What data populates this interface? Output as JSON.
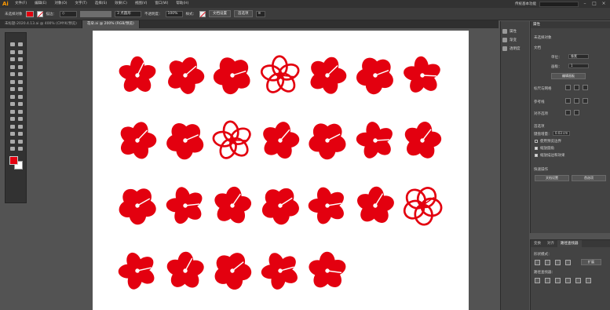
{
  "app": {
    "logo": "Ai"
  },
  "menu": [
    "文件(F)",
    "编辑(E)",
    "对象(O)",
    "文字(T)",
    "选择(S)",
    "效果(C)",
    "视图(V)",
    "窗口(W)",
    "帮助(H)"
  ],
  "workspace": "传统基本功能",
  "control_bar": {
    "selection_label": "未选择对象",
    "stroke_label": "描边：",
    "brush_label": "3 点圆形",
    "opacity_label": "不透明度：",
    "opacity_value": "100%",
    "style_label": "样式：",
    "doc_setup_button": "文档设置",
    "prefs_button": "首选项"
  },
  "document_tabs": [
    {
      "label": "未标题-2020.4.13.ai @ 400% (CMYK/预览)",
      "active": false
    },
    {
      "label": "花朵.ai @ 200% (RGB/预览)",
      "active": true
    }
  ],
  "dock": [
    "属性",
    "渐变",
    "透明度"
  ],
  "properties": {
    "title": "属性",
    "no_selection": "未选择对象",
    "document_section": "文档",
    "units_label": "单位：",
    "units_value": "像素",
    "artboard_label": "画板：",
    "artboard_value": "1",
    "edit_artboard_button": "编辑画板",
    "ruler_grid_label": "标尺与网格",
    "guides_label": "参考线",
    "align_label": "对齐选项",
    "prefs_label": "首选项",
    "keyboard_increment_label": "键盘增量：",
    "keyboard_increment_value": "0.03 cm",
    "checkbox_1": "使用预览边界",
    "checkbox_2": "缩放圆角",
    "checkbox_3": "缩放描边和效果",
    "quick_actions_label": "快速操作",
    "doc_setup_button": "文档设置",
    "prefs_button": "首选项"
  },
  "pathfinder": {
    "tabs": [
      "变换",
      "对齐",
      "路径查找器"
    ],
    "shape_modes_label": "形状模式：",
    "expand_button": "扩展",
    "pathfinders_label": "路径查找器："
  },
  "colors": {
    "flower": "#e3000f",
    "canvas": "#ffffff",
    "workspace": "#535353"
  },
  "flowers_per_row": [
    7,
    7,
    7,
    5
  ]
}
